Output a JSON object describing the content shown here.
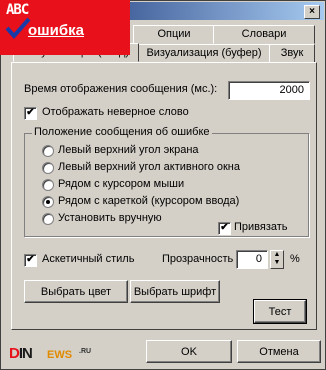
{
  "overlay": {
    "abc": "ABC",
    "word": "ошибка"
  },
  "window": {
    "close_glyph": "×"
  },
  "tabs": [
    {
      "label": "Визуализация (ввод)"
    },
    {
      "label": "Опции"
    },
    {
      "label": "Словари"
    },
    {
      "label": "Визуализация (буфер)"
    },
    {
      "label": "Звук"
    }
  ],
  "settings": {
    "display_time_label": "Время отображения сообщения (мс.):",
    "display_time_value": "2000",
    "show_wrong_word_label": "Отображать неверное слово",
    "show_wrong_word_checked": "✔",
    "position_group_title": "Положение сообщения об ошибке",
    "positions": [
      {
        "label": "Левый верхний угол экрана",
        "selected": false
      },
      {
        "label": "Левый верхний угол активного окна",
        "selected": false
      },
      {
        "label": "Рядом с курсором мыши",
        "selected": false
      },
      {
        "label": "Рядом с кареткой (курсором ввода)",
        "selected": true
      },
      {
        "label": "Установить вручную",
        "selected": false
      }
    ],
    "snap_label": "Привязать",
    "snap_checked": "✔",
    "ascetic_label": "Аскетичный стиль",
    "ascetic_checked": "✔",
    "transparency_label": "Прозрачность",
    "transparency_value": "0",
    "transparency_unit": "%",
    "spin_up": "▲",
    "spin_down": "▼",
    "choose_color_label": "Выбрать цвет",
    "choose_font_label": "Выбрать шрифт",
    "test_label": "Тест"
  },
  "footer": {
    "ok_label": "OK",
    "cancel_label": "Отмена",
    "logo": {
      "din_d": "D",
      "din_rest": "IN",
      "news": "EWS",
      "ru": ".RU"
    }
  }
}
